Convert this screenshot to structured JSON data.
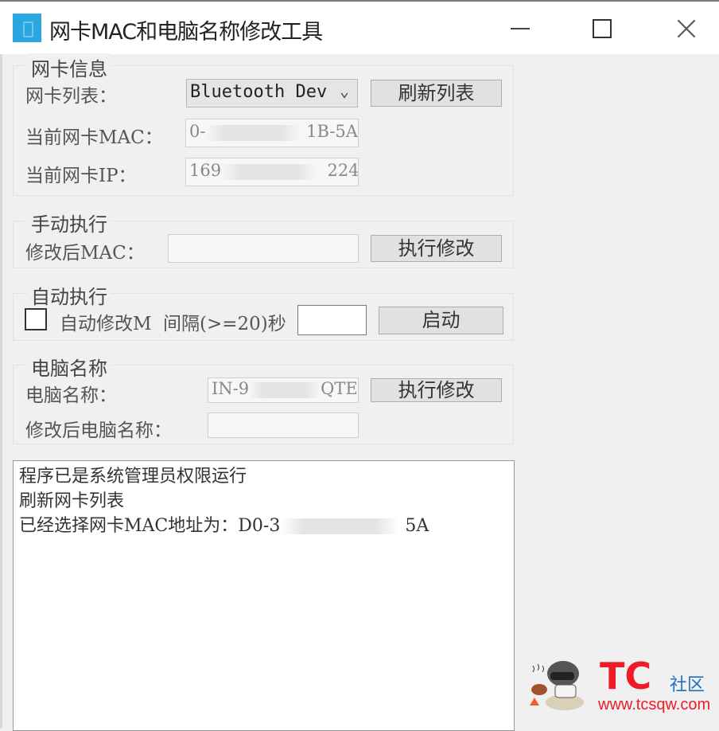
{
  "window": {
    "title": "网卡MAC和电脑名称修改工具",
    "icon": "app-icon",
    "controls": [
      "minimize-icon",
      "maximize-icon",
      "close-icon"
    ]
  },
  "nic_info": {
    "group_title": "网卡信息",
    "list_label": "网卡列表：",
    "list_selected": "Bluetooth Dev",
    "refresh_button": "刷新列表",
    "mac_label": "当前网卡MAC：",
    "mac_value_start": "0-",
    "mac_value_end": "1B-5A",
    "ip_label": "当前网卡IP：",
    "ip_value_start": "169",
    "ip_value_end": "224"
  },
  "manual": {
    "group_title": "手动执行",
    "mac_label": "修改后MAC：",
    "mac_input": "",
    "execute_button": "执行修改"
  },
  "auto": {
    "group_title": "自动执行",
    "checkbox_label": "自动修改M",
    "checked": false,
    "interval_label": "间隔(>=20)秒",
    "interval_input": "",
    "start_button": "启动"
  },
  "computer_name": {
    "group_title": "电脑名称",
    "name_label": "电脑名称：",
    "name_value_start": "IN-9",
    "name_value_end": "QTE",
    "execute_button": "执行修改",
    "new_name_label": "修改后电脑名称：",
    "new_name_input": ""
  },
  "log": {
    "lines": [
      "程序已是系统管理员权限运行",
      "刷新网卡列表",
      "已经选择网卡MAC地址为：D0-3"
    ],
    "line3_end": "5A"
  },
  "watermark": {
    "brand": "TC",
    "community": "社区",
    "url": "www.tcsqw.com"
  }
}
